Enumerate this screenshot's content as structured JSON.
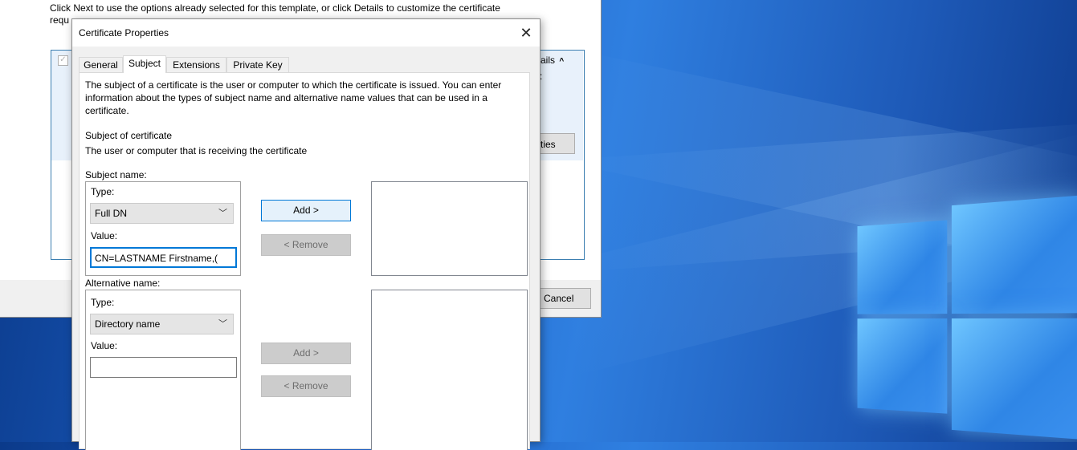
{
  "wizard": {
    "intro_line1": "Click Next to use the options already selected for this template, or click Details to customize the certificate",
    "intro_line2": "requ",
    "details_label": "ails",
    "details_chevron": "^",
    "details_sub": ":",
    "properties_button": "ties",
    "cancel_button": "Cancel"
  },
  "dialog": {
    "title": "Certificate Properties",
    "close_icon": "close-icon",
    "tabs": [
      {
        "label": "General",
        "active": false
      },
      {
        "label": "Subject",
        "active": true
      },
      {
        "label": "Extensions",
        "active": false
      },
      {
        "label": "Private Key",
        "active": false
      }
    ],
    "description": "The subject of a certificate is the user or computer to which the certificate is issued. You can enter information about the types of subject name and alternative name values that can be used in a certificate.",
    "subject_heading": "Subject of certificate",
    "subject_subheading": "The user or computer that is receiving the certificate",
    "subject_name": {
      "label": "Subject name:",
      "type_label": "Type:",
      "type_value": "Full DN",
      "value_label": "Value:",
      "value_text": "CN=LASTNAME Firstname,(",
      "add_button": "Add >",
      "remove_button": "< Remove"
    },
    "alternative_name": {
      "label": "Alternative name:",
      "type_label": "Type:",
      "type_value": "Directory name",
      "value_label": "Value:",
      "value_text": "",
      "add_button": "Add >",
      "remove_button": "< Remove"
    }
  },
  "colors": {
    "accent": "#0078d7",
    "desktop_blue": "#1c5fc4"
  }
}
